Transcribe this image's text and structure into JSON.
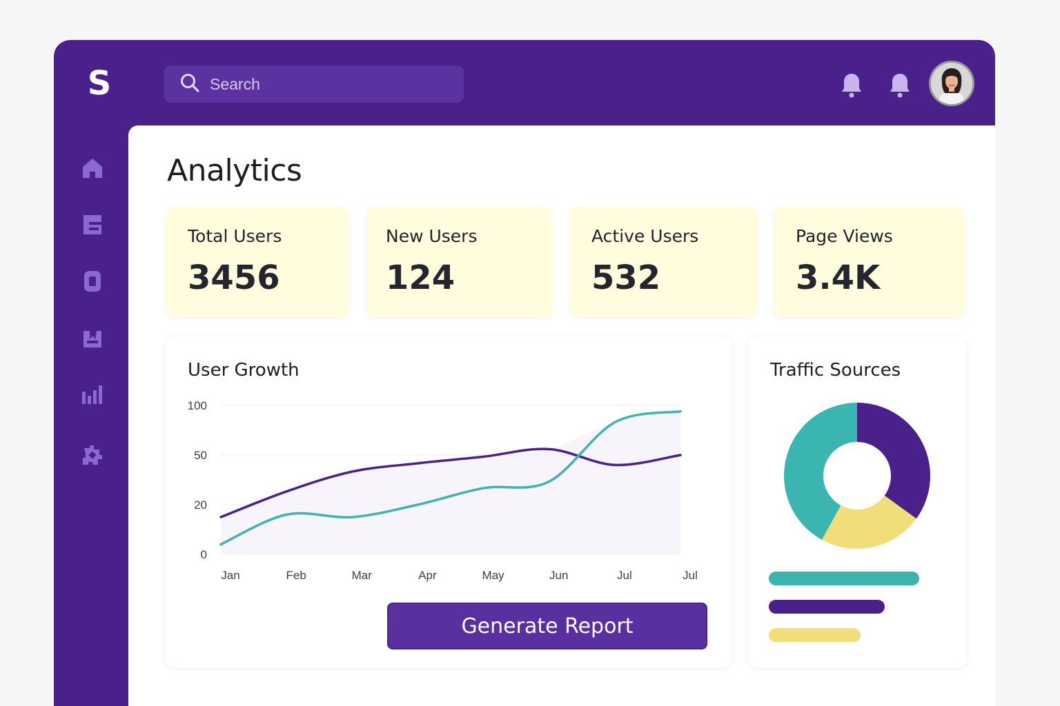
{
  "header": {
    "logo_text": "S",
    "search": {
      "placeholder": "Search",
      "value": ""
    },
    "notifications": [
      "bell-icon",
      "bell-icon"
    ],
    "avatar": "user-avatar"
  },
  "sidebar": {
    "items": [
      "home-icon",
      "document-icon",
      "box-icon",
      "gallery-icon",
      "bar-chart-icon",
      "puzzle-icon"
    ]
  },
  "page": {
    "title": "Analytics"
  },
  "stats": [
    {
      "label": "Total Users",
      "value": "3456"
    },
    {
      "label": "New Users",
      "value": "124"
    },
    {
      "label": "Active Users",
      "value": "532"
    },
    {
      "label": "Page Views",
      "value": "3.4K"
    }
  ],
  "user_growth": {
    "title": "User Growth",
    "button_label": "Generate Report"
  },
  "traffic": {
    "title": "Traffic Sources",
    "legend": [
      {
        "color": "#3ab5b0",
        "length": 1.0
      },
      {
        "color": "#4a208a",
        "length": 0.77
      },
      {
        "color": "#f2de78",
        "length": 0.61
      }
    ]
  },
  "colors": {
    "brand": "#4a208a",
    "teal": "#3ab5b0",
    "yellow": "#f2de78",
    "card_bg": "#fffdde"
  },
  "chart_data": [
    {
      "type": "line",
      "title": "User Growth",
      "xlabel": "",
      "ylabel": "",
      "categories": [
        "Jan",
        "Feb",
        "Mar",
        "Apr",
        "May",
        "Jun",
        "Jul",
        "Jul"
      ],
      "y_ticks": [
        0,
        20,
        50,
        100
      ],
      "ylim": [
        0,
        100
      ],
      "grid": true,
      "series": [
        {
          "color": "#4a208a",
          "values": [
            15,
            28,
            40,
            45,
            49,
            56,
            44,
            50
          ]
        },
        {
          "color": "#3ab5b0",
          "values": [
            4,
            16,
            15,
            20,
            30,
            34,
            83,
            94
          ]
        }
      ]
    },
    {
      "type": "pie",
      "title": "Traffic Sources",
      "donut": true,
      "slices": [
        {
          "color": "#4a208a",
          "value": 35
        },
        {
          "color": "#f2de78",
          "value": 23
        },
        {
          "color": "#3ab5b0",
          "value": 42
        }
      ]
    }
  ]
}
